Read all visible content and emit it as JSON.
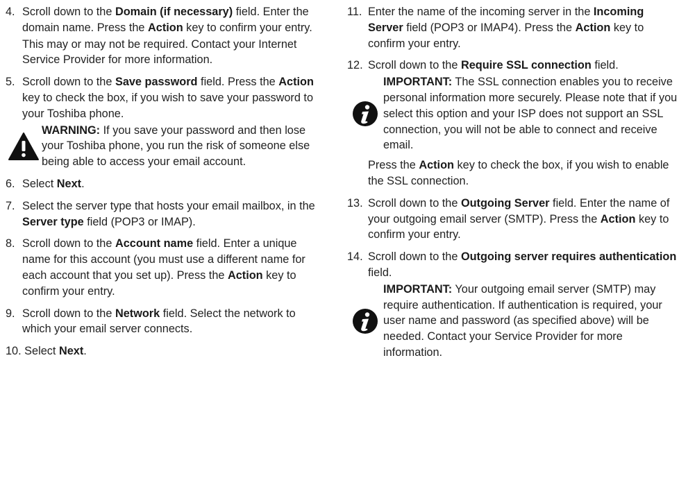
{
  "left": {
    "s4": {
      "num": "4.",
      "pre": "Scroll down to the ",
      "b1": "Domain (if necessary)",
      "mid": " field. Enter the domain name. Press the ",
      "b2": "Action",
      "post": " key to confirm your entry.",
      "extra": "This may or may not be required. Contact your Internet Service Provider for more information."
    },
    "s5": {
      "num": "5.",
      "pre": "Scroll down to the ",
      "b1": "Save password",
      "mid": " field. Press the ",
      "b2": "Action",
      "post": " key to check the box, if you wish to save your password to your Toshiba phone."
    },
    "warning": {
      "icon": "warning-triangle-icon",
      "label": "WARNING:",
      "text": " If you save your password and then lose your Toshiba phone, you run the risk of someone else being able to access your email account."
    },
    "s6": {
      "num": "6.",
      "pre": "Select ",
      "b1": "Next",
      "post": "."
    },
    "s7": {
      "num": "7.",
      "pre": "Select the server type that hosts your email mailbox, in the ",
      "b1": "Server type",
      "post": " field (POP3 or IMAP)."
    },
    "s8": {
      "num": "8.",
      "pre": "Scroll down to the ",
      "b1": "Account name",
      "mid": " field. Enter a unique name for this account (you must use a different name for each account that you set up). Press the ",
      "b2": "Action",
      "post": " key to confirm your entry."
    },
    "s9": {
      "num": "9.",
      "pre": "Scroll down to the ",
      "b1": "Network",
      "post": " field. Select the network to which your email server connects."
    },
    "s10": {
      "num": "10.",
      "pre": "Select ",
      "b1": "Next",
      "post": "."
    }
  },
  "right": {
    "s11": {
      "num": "11.",
      "pre": "Enter the name of the incoming server in the ",
      "b1": "Incoming Server",
      "mid": " field (POP3 or IMAP4). Press the ",
      "b2": "Action",
      "post": " key to confirm your entry."
    },
    "s12": {
      "num": "12.",
      "pre": "Scroll down to the ",
      "b1": "Require SSL connection",
      "post": " field."
    },
    "note1": {
      "icon": "info-icon",
      "label": "IMPORTANT:",
      "text": " The SSL connection enables you to receive personal information more securely. Please note that if you select this option and your ISP does not support an SSL connection, you will not be able to connect and receive email."
    },
    "after12": {
      "pre": "Press the ",
      "b1": "Action",
      "post": " key to check the box, if you wish to enable the SSL connection."
    },
    "s13": {
      "num": "13.",
      "pre": "Scroll down to the ",
      "b1": "Outgoing Server",
      "mid": " field. Enter the name of your outgoing email server (SMTP). Press the ",
      "b2": "Action",
      "post": " key to confirm your entry."
    },
    "s14": {
      "num": "14.",
      "pre": "Scroll down to the ",
      "b1": "Outgoing server requires authentication",
      "post": " field."
    },
    "note2": {
      "icon": "info-icon",
      "label": "IMPORTANT:",
      "text": " Your outgoing email server (SMTP) may require authentication. If authentication is required, your user name and password (as specified above) will be needed. Contact your Service Provider for more information."
    }
  }
}
